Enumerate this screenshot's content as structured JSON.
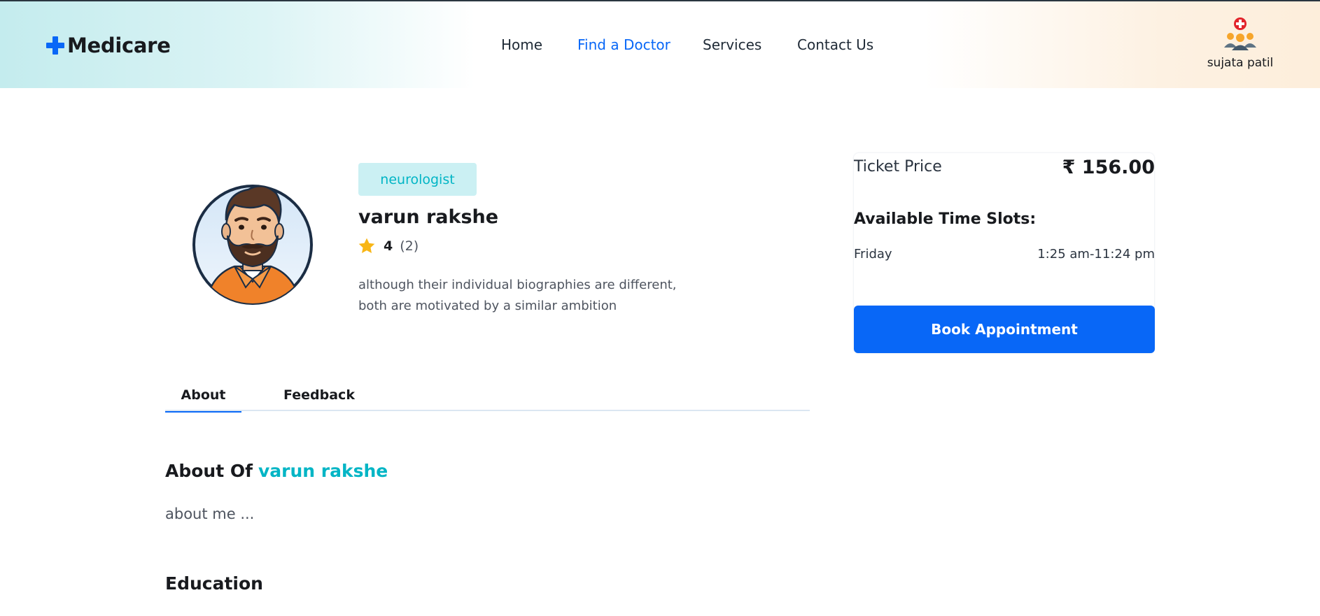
{
  "brand": {
    "name": "Medicare",
    "accent": "#0867f7",
    "teal": "#01b5c5"
  },
  "nav": {
    "items": [
      {
        "label": "Home"
      },
      {
        "label": "Find a Doctor",
        "active": true
      },
      {
        "label": "Services"
      },
      {
        "label": "Contact Us"
      }
    ]
  },
  "user": {
    "name": "sujata patil",
    "icon": "user-group-medical-icon"
  },
  "doctor": {
    "specialization": "neurologist",
    "name": "varun rakshe",
    "avg_rating": "4",
    "total_ratings": "(2)",
    "bio": "although their individual biographies are different, both are motivated by a similar ambition",
    "photo_icon": "doctor-avatar-icon"
  },
  "tabs": [
    {
      "label": "About",
      "active": true
    },
    {
      "label": "Feedback"
    }
  ],
  "about": {
    "heading": "About Of",
    "name": "varun rakshe",
    "text": "about me ...",
    "education_heading": "Education"
  },
  "booking": {
    "price_label": "Ticket Price",
    "price": "₹ 156.00",
    "slots_title": "Available Time Slots:",
    "slots": [
      {
        "day": "Friday",
        "time": "1:25 am-11:24 pm"
      }
    ],
    "button_label": "Book Appointment"
  }
}
